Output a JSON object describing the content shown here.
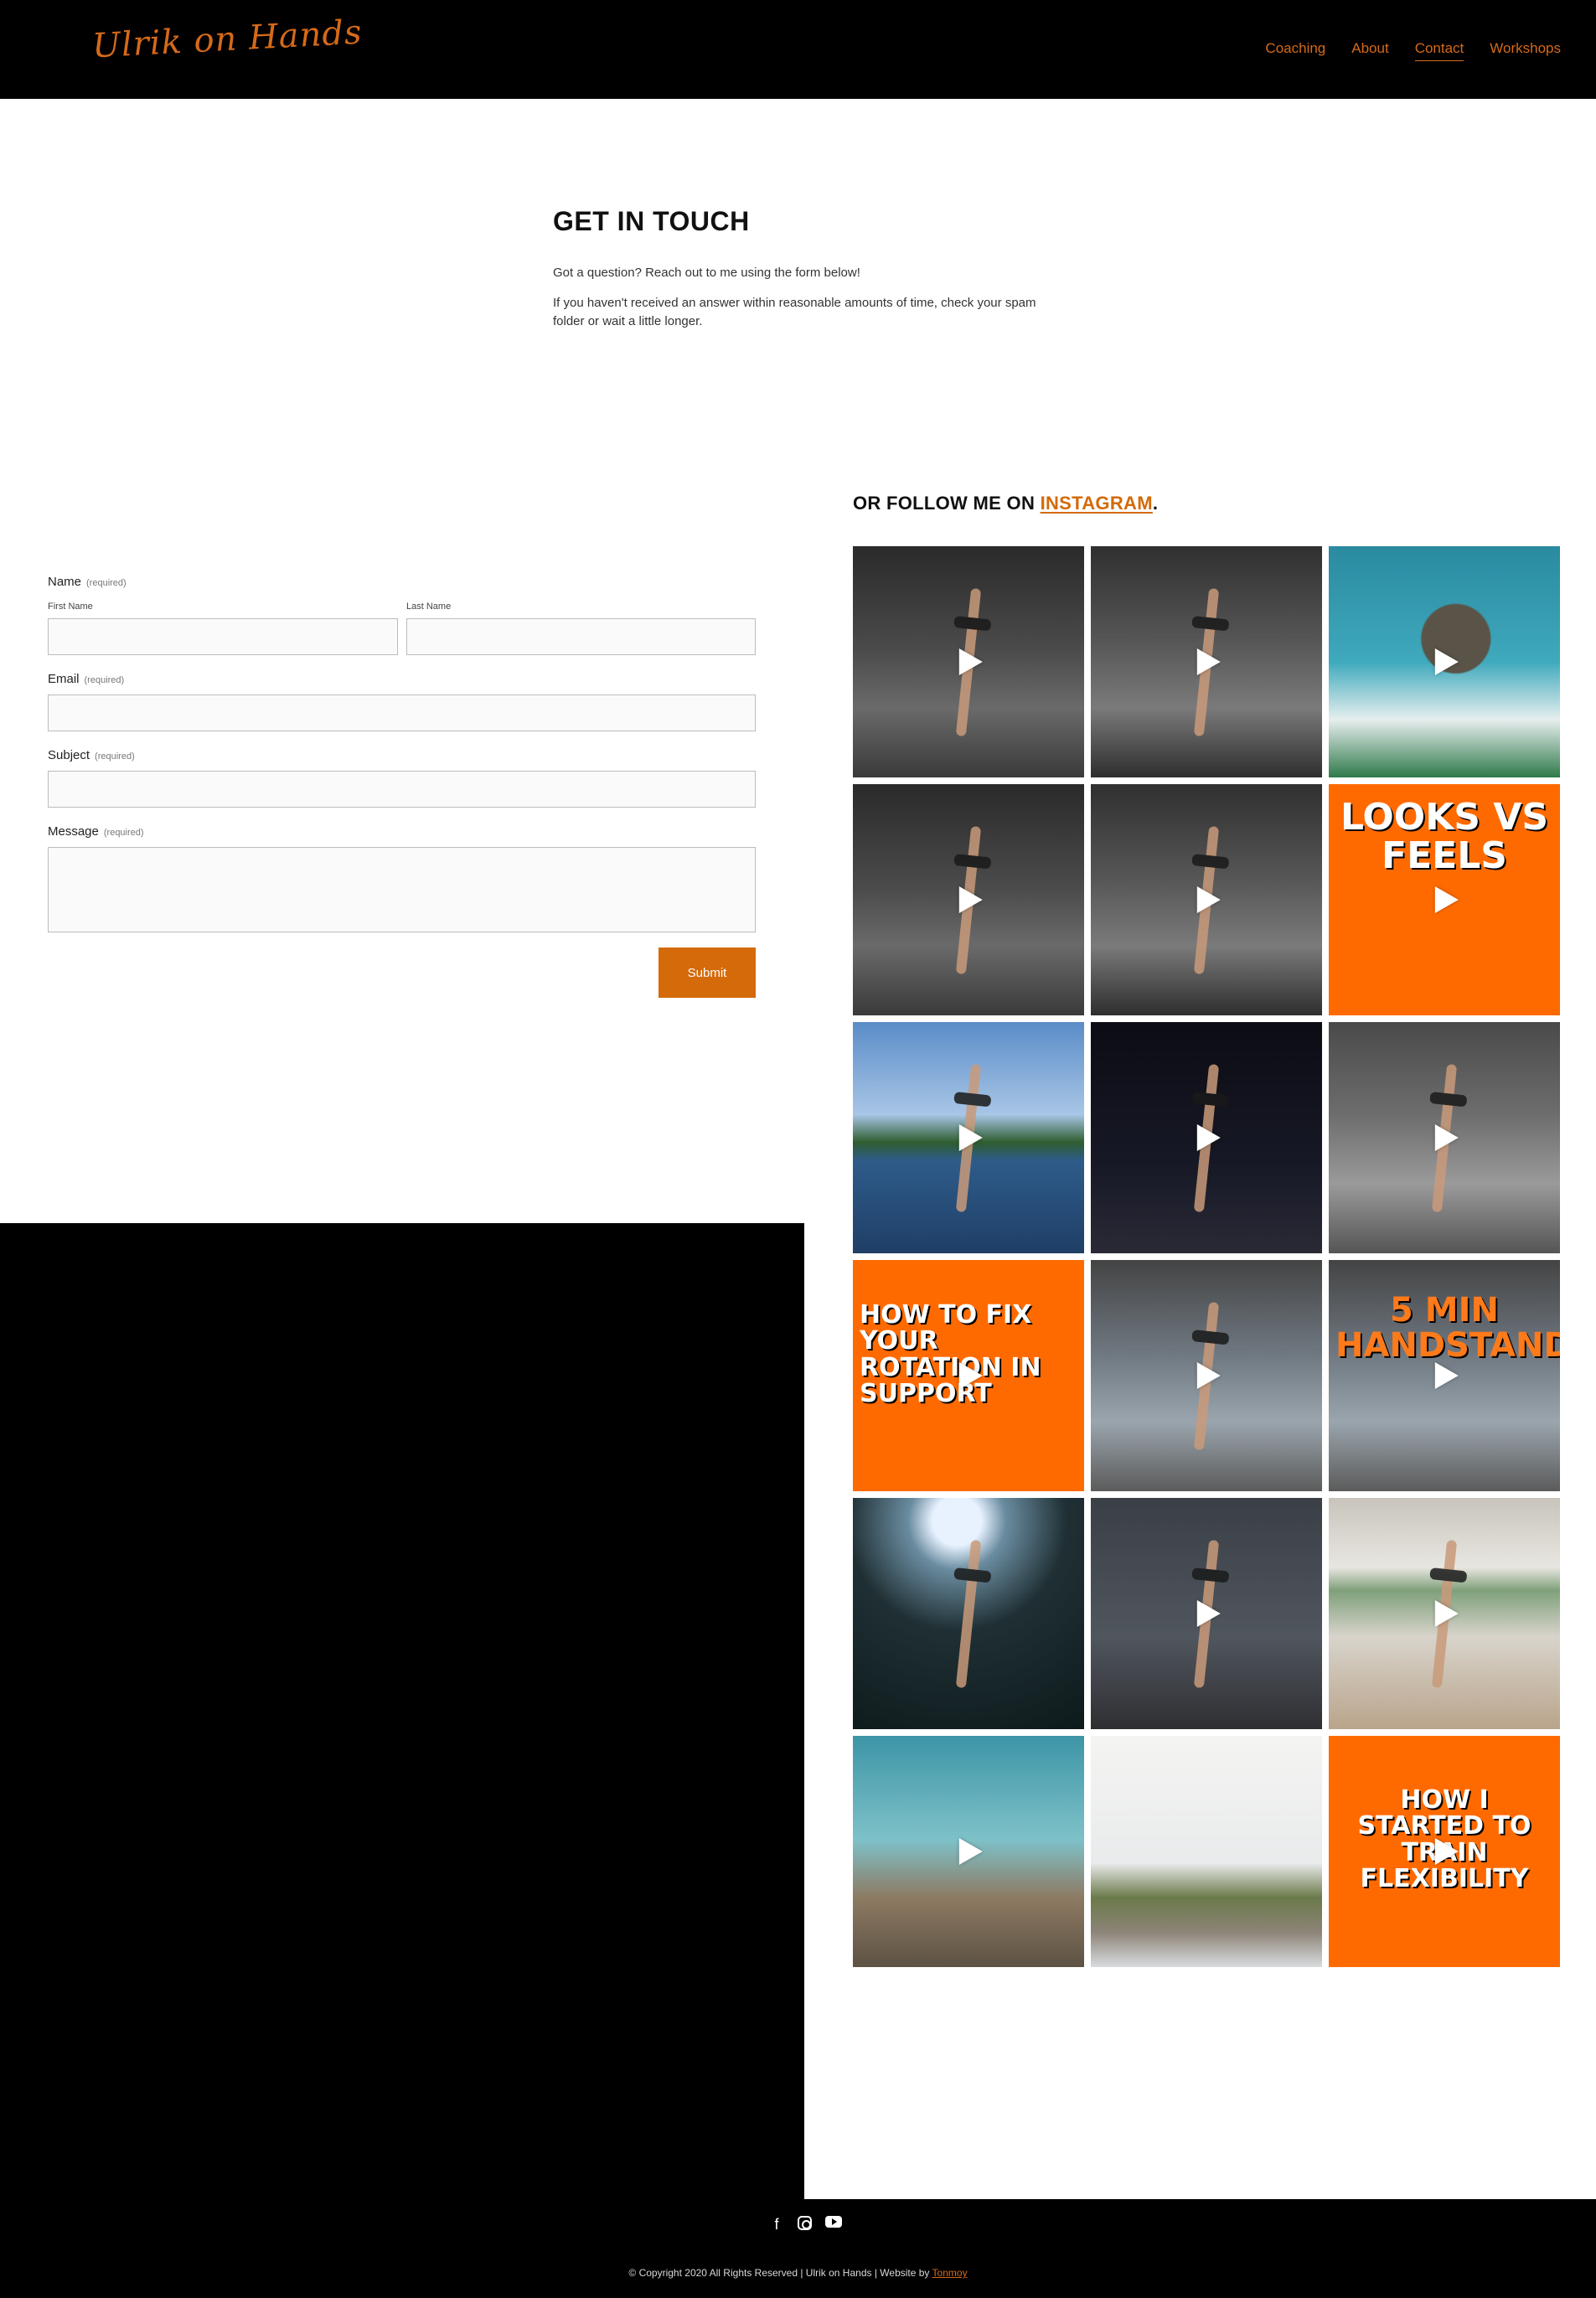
{
  "header": {
    "logo_text": "Ulrik on Hands",
    "nav": [
      {
        "label": "Coaching"
      },
      {
        "label": "About"
      },
      {
        "label": "Contact"
      },
      {
        "label": "Workshops"
      }
    ]
  },
  "intro": {
    "title": "GET IN TOUCH",
    "line1": "Got a question? Reach out to me using the form below!",
    "line2": "If you haven't received an answer within reasonable amounts of time, check your spam folder or wait a little longer."
  },
  "form": {
    "name_label": "Name",
    "required": "(required)",
    "first_name_label": "First Name",
    "last_name_label": "Last Name",
    "email_label": "Email",
    "subject_label": "Subject",
    "message_label": "Message",
    "submit_label": "Submit"
  },
  "instagram": {
    "title_prefix": "OR FOLLOW ME ON ",
    "link_text": "INSTAGRAM",
    "title_suffix": ".",
    "tile_texts": {
      "looks": "LOOKS VS FEELS",
      "rotation": "HOW TO FIX YOUR ROTATION IN SUPPORT",
      "min": "5 MIN HANDSTAND",
      "flex": "HOW I STARTED TO TRAIN FLEXIBILITY"
    }
  },
  "footer": {
    "social": [
      "facebook-icon",
      "instagram-icon",
      "youtube-icon"
    ],
    "copyright": "© Copyright 2020 All Rights Reserved | Ulrik on Hands | Website by ",
    "credit": "Tonmoy"
  },
  "colors": {
    "accent": "#d46a0a",
    "header_bg": "#000000"
  }
}
